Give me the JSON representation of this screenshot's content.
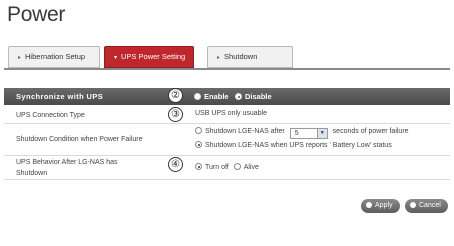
{
  "page": {
    "title": "Power"
  },
  "tabs": [
    {
      "label": "Hibernation Setup",
      "active": false
    },
    {
      "label": "UPS Power Setting",
      "active": true
    },
    {
      "label": "Shutdown",
      "active": false
    }
  ],
  "sync": {
    "label": "Synchronize with UPS",
    "marker": "②",
    "options": [
      "Enable",
      "Disable"
    ],
    "selected": "Disable"
  },
  "connection": {
    "label": "UPS Connection Type",
    "marker": "③",
    "value": "USB UPS only usuable"
  },
  "shutdown_condition": {
    "label": "Shutdown Condition when Power Failure",
    "option1_prefix": "Shutdown LGE-NAS after",
    "delay_value": "5",
    "option1_suffix": "seconds of power failure",
    "option2": "Shutdown LGE-NAS when UPS reports ' Battery Low' status",
    "selected": "option2"
  },
  "behavior": {
    "label_line1": "UPS Behavior After LG-NAS has",
    "label_line2": "Shutdown",
    "marker": "④",
    "options": [
      "Turn off",
      "Alive"
    ],
    "selected": "Turn off"
  },
  "buttons": {
    "apply": "Apply",
    "cancel": "Cancel"
  },
  "icons": {
    "tab_chevron": "chevron-right-icon",
    "active_tab_chevron": "chevron-down-icon",
    "select_arrow": "chevron-down-icon"
  },
  "colors": {
    "active_tab": "#c0272d",
    "header_bar": "#555555",
    "button": "#707070"
  }
}
